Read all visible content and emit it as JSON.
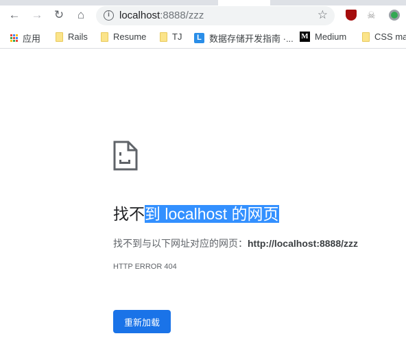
{
  "browser": {
    "address": {
      "host": "localhost",
      "path": ":8888/zzz"
    },
    "bookmarks": [
      {
        "label": "应用",
        "icon": "apps-grid-icon"
      },
      {
        "label": "Rails",
        "icon": "folder-icon"
      },
      {
        "label": "Resume",
        "icon": "folder-icon"
      },
      {
        "label": "TJ",
        "icon": "folder-icon"
      },
      {
        "label": "数据存储开发指南 ·...",
        "icon": "L-site-icon"
      },
      {
        "label": "Medium",
        "icon": "medium-icon"
      },
      {
        "label": "CSS ma",
        "icon": "folder-icon"
      }
    ]
  },
  "page": {
    "title_plain": "找不",
    "title_selected": "到 localhost 的网页",
    "desc": "找不到与以下网址对应的网页：",
    "url": "http://localhost:8888/zzz",
    "error_code": "HTTP ERROR 404",
    "reload_label": "重新加载"
  },
  "colors": {
    "accent": "#1a73e8",
    "selection": "#3390ff"
  }
}
